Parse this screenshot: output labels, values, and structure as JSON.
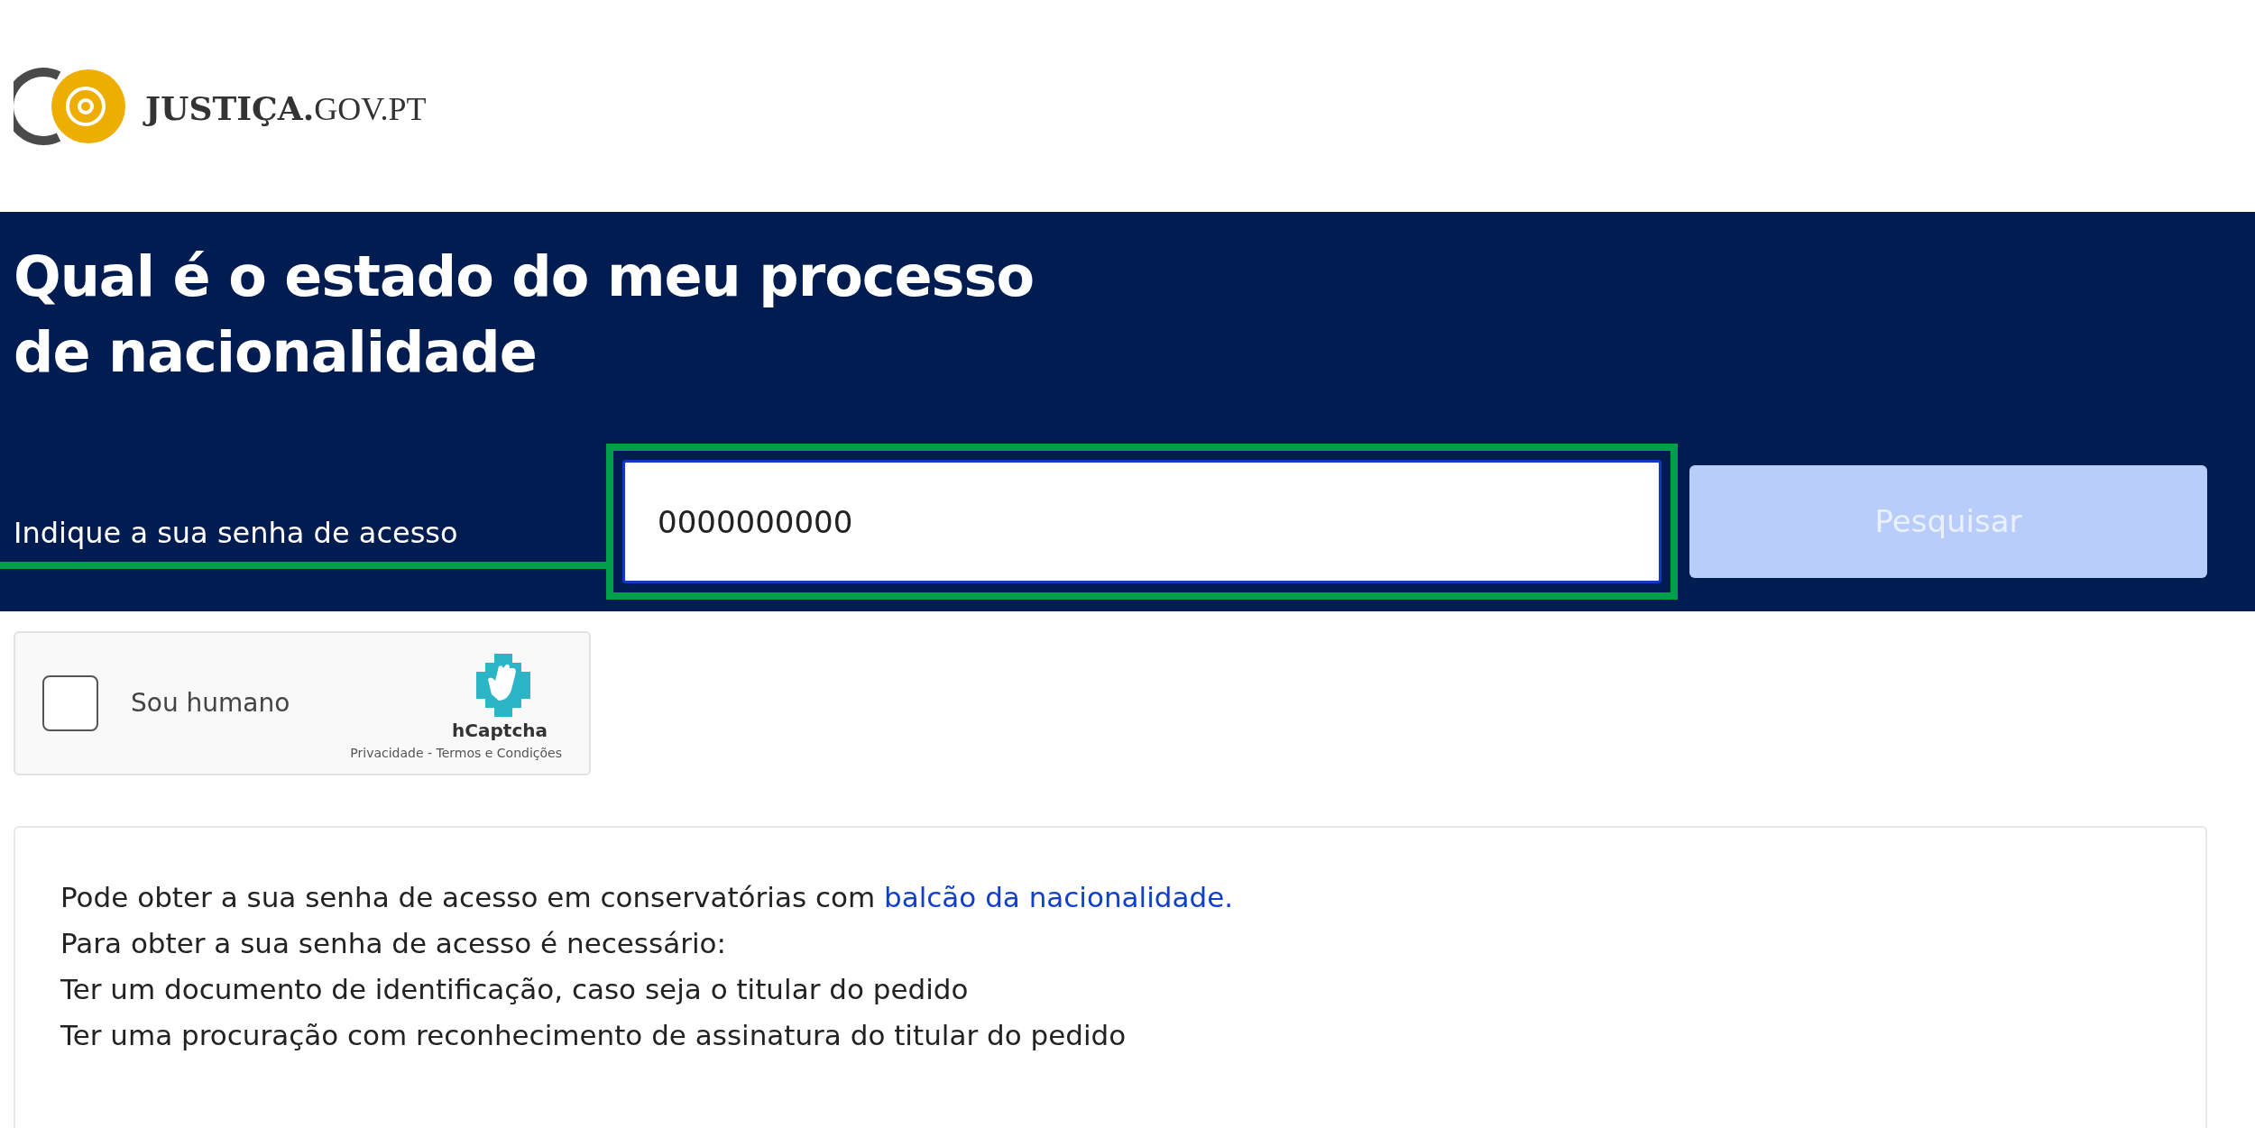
{
  "header": {
    "logo": {
      "bold": "JUSTIÇA.",
      "light": "GOV.PT"
    }
  },
  "hero": {
    "title": "Qual é o estado do meu processo de nacionalidade",
    "label": "Indique a sua senha de acesso",
    "label_highlighted": true,
    "field": {
      "value": "0000000000",
      "highlighted": true
    },
    "button": {
      "label": "Pesquisar",
      "disabled": true
    }
  },
  "captcha": {
    "label": "Sou humano",
    "checked": false,
    "brand": "hCaptcha",
    "links": "Privacidade - Termos e Condições"
  },
  "info": {
    "lines": [
      {
        "text": "Pode obter a sua senha de acesso em conservatórias com ",
        "link": "balcão da nacionalidade."
      },
      {
        "text": "Para obter a sua senha de acesso é necessário:"
      },
      {
        "text": "Ter um documento de identificação, caso seja o titular do pedido"
      },
      {
        "text": "Ter uma procuração com reconhecimento de assinatura do titular do pedido"
      }
    ]
  }
}
